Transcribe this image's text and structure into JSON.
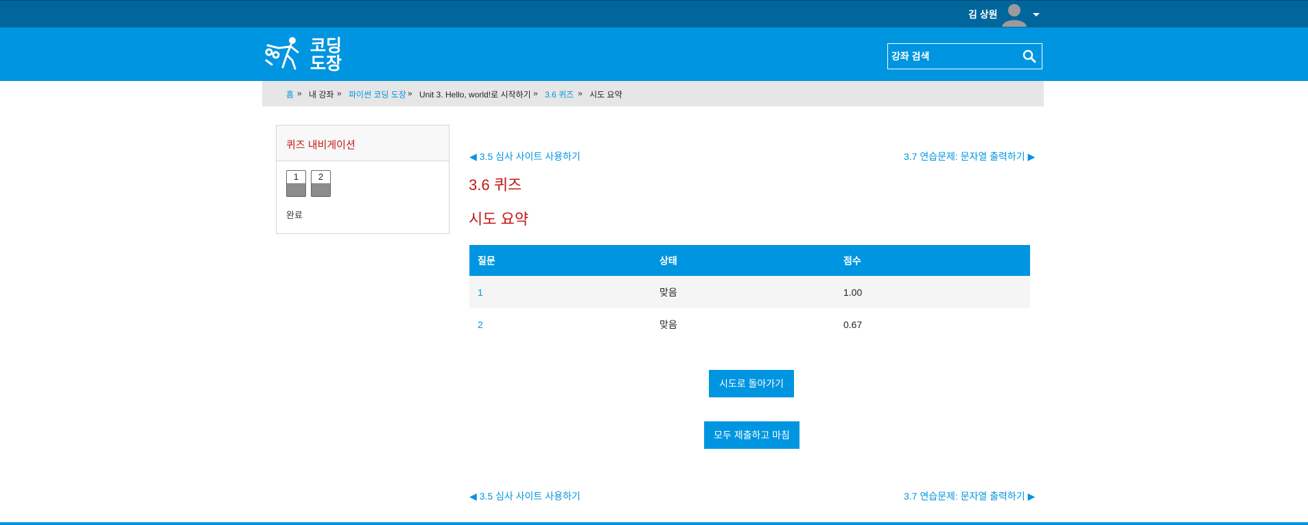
{
  "user": {
    "name": "김 상원"
  },
  "brand": {
    "logo_text_line1": "코딩",
    "logo_text_line2": "도장"
  },
  "search": {
    "placeholder": "강좌 검색"
  },
  "breadcrumb": [
    "홈",
    "내 강좌",
    "파이썬 코딩 도장",
    "Unit 3. Hello, world!로 시작하기",
    "3.6 퀴즈",
    "시도 요약"
  ],
  "quiz_nav": {
    "title": "퀴즈 내비게이션",
    "questions": [
      "1",
      "2"
    ],
    "finish_label": "완료"
  },
  "nav": {
    "prev": "◀ 3.5 심사 사이트 사용하기",
    "next": "3.7 연습문제: 문자열 출력하기 ▶"
  },
  "page_title": "3.6 퀴즈",
  "section_title": "시도 요약",
  "table": {
    "headers": [
      "질문",
      "상태",
      "점수"
    ],
    "rows": [
      [
        "1",
        "맞음",
        "1.00"
      ],
      [
        "2",
        "맞음",
        "0.67"
      ]
    ]
  },
  "buttons": {
    "return": "시도로 돌아가기",
    "submit": "모두 제출하고 마침"
  },
  "colors": {
    "primary": "#0095e0",
    "topbar": "#00669c",
    "accent_red": "#c51515"
  }
}
